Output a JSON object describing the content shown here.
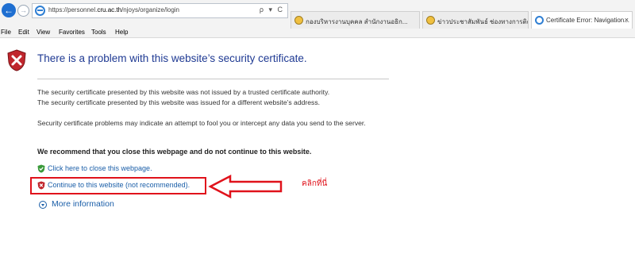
{
  "browser": {
    "url_prefix": "https://personnel.",
    "url_host": "cru.ac.th",
    "url_path": "/njoys/organize/login",
    "address_tools": "ρ ▾ C",
    "tabs": [
      {
        "label": "กองบริหารงานบุคคล สำนักงานอธิก...",
        "active": false
      },
      {
        "label": "ข่าวประชาสัมพันธ์ ช่องทางการติดตาม...",
        "active": false
      },
      {
        "label": "Certificate Error: Navigation...",
        "active": true
      }
    ],
    "close_symbol": "×",
    "menu": [
      "File",
      "Edit",
      "View",
      "Favorites",
      "Tools",
      "Help"
    ]
  },
  "page": {
    "title": "There is a problem with this website’s security certificate.",
    "paragraph1": "The security certificate presented by this website was not issued by a trusted certificate authority.",
    "paragraph2": "The security certificate presented by this website was issued for a different website’s address.",
    "paragraph3": "Security certificate problems may indicate an attempt to fool you or intercept any data you send to the server.",
    "recommendation": "We recommend that you close this webpage and do not continue to this website.",
    "close_link": "Click here to close this webpage.",
    "continue_link": "Continue to this website (not recommended).",
    "more_info": "More information"
  },
  "annotation": {
    "label": "คลิกที่นี่",
    "color": "#e0121b"
  },
  "colors": {
    "title_blue": "#1f3a93",
    "link_blue": "#1a5ea8",
    "shield_red": "#c0262d",
    "shield_green": "#3a9a3a"
  }
}
